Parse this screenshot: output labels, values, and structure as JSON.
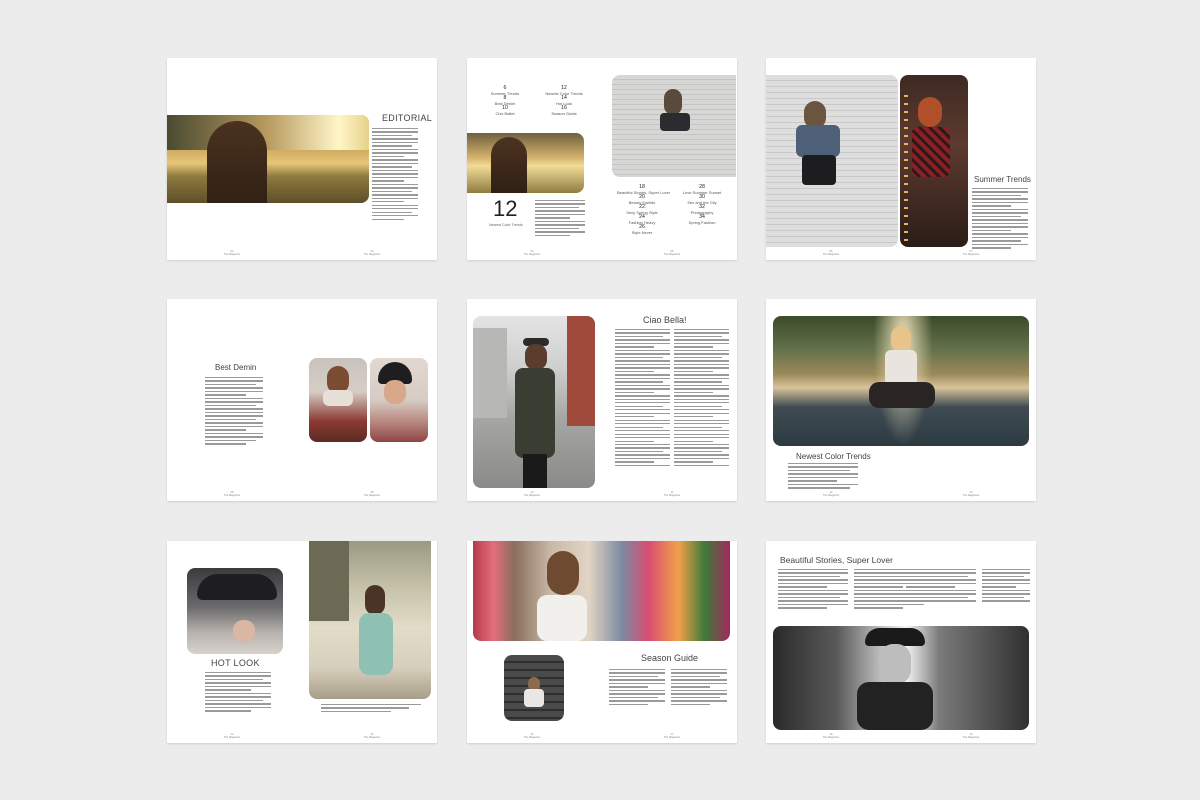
{
  "headings": {
    "editorial": "EDITORIAL",
    "summer_trends": "Summer Trends",
    "best_demin": "Best Demin",
    "ciao_bella": "Ciao Bella!",
    "newest_color_trends": "Newest Color Trends",
    "hot_look": "HOT LOOK",
    "season_guide": "Season Guide",
    "beautiful_stories": "Beautiful Stories, Super Lover"
  },
  "toc": {
    "big_number": "12",
    "big_caption": "Newest Color Trends",
    "top_left": [
      {
        "n": "6",
        "t": "Summer Trends"
      },
      {
        "n": "8",
        "t": "Best Denim"
      },
      {
        "n": "10",
        "t": "Chic Ballet"
      }
    ],
    "top_right": [
      {
        "n": "12",
        "t": "Newest Color Trends"
      },
      {
        "n": "14",
        "t": "Hot Look"
      },
      {
        "n": "16",
        "t": "Season Guide"
      }
    ],
    "bottom_left": [
      {
        "n": "18",
        "t": "Beautiful Stories, Super Lover"
      },
      {
        "n": "20",
        "t": "Beauty Eyelids"
      },
      {
        "n": "22",
        "t": "Sexy Spring Style"
      },
      {
        "n": "24",
        "t": "Fashion Heavy"
      },
      {
        "n": "26",
        "t": "Style Never"
      }
    ],
    "bottom_right": [
      {
        "n": "28",
        "t": "Love Summer Sunset"
      },
      {
        "n": "30",
        "t": "Sex and the City"
      },
      {
        "n": "32",
        "t": "Photography"
      },
      {
        "n": "34",
        "t": "Spring Fashion"
      }
    ]
  },
  "folio": {
    "magazine_name": "The Magazine",
    "pages": [
      "02",
      "03",
      "04",
      "05",
      "06",
      "07",
      "08",
      "09",
      "10",
      "11",
      "12",
      "13",
      "14",
      "15",
      "16",
      "17",
      "18",
      "19"
    ]
  },
  "colors": {
    "background": "#ececec",
    "page": "#ffffff",
    "text_gray": "#9a9a9a"
  }
}
